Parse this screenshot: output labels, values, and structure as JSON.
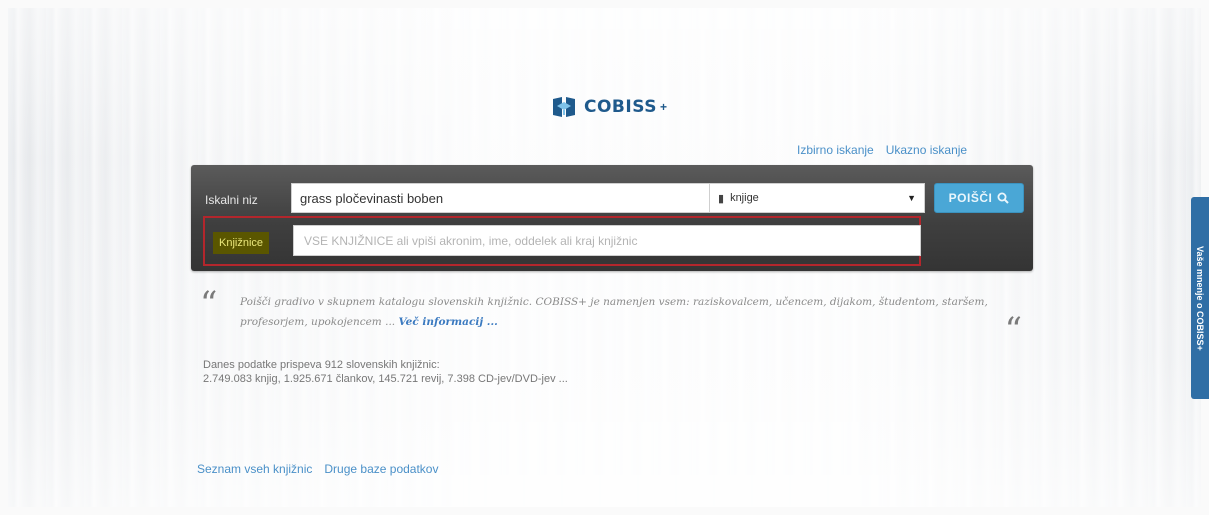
{
  "logo": {
    "text": "COBISS",
    "plus": "+",
    "mark": "cobiss-logo-icon"
  },
  "top_links": {
    "advanced": "Izbirno iskanje",
    "command": "Ukazno iskanje"
  },
  "search": {
    "label": "Iskalni niz",
    "value": "grass pločevinasti boben",
    "type_icon": "book-icon",
    "type_value": "knjige",
    "button_label": "POIŠČI",
    "button_icon": "search-icon",
    "button_color": "#4aa7d6"
  },
  "libraries": {
    "label": "Knjižnice",
    "placeholder": "VSE KNJIŽNICE ali vpiši akronim, ime, oddelek ali kraj knjižnic",
    "highlight_color": "#b3262c"
  },
  "intro": {
    "text": "Poišči gradivo v skupnem katalogu slovenskih knjižnic. COBISS+ je namenjen vsem: raziskovalcem, učencem, dijakom, študentom, staršem, profesorjem, upokojencem ...",
    "more_link": "Več informacij ..."
  },
  "stats": {
    "line1": "Danes podatke prispeva 912 slovenskih knjižnic:",
    "line2": "2.749.083 knjig, 1.925.671 člankov, 145.721 revij, 7.398 CD-jev/DVD-jev ..."
  },
  "bottom_links": {
    "libraries_list": "Seznam vseh knjižnic",
    "other_db": "Druge baze podatkov"
  },
  "side_tab": {
    "label": "Vaše mnenje o COBISS+"
  }
}
